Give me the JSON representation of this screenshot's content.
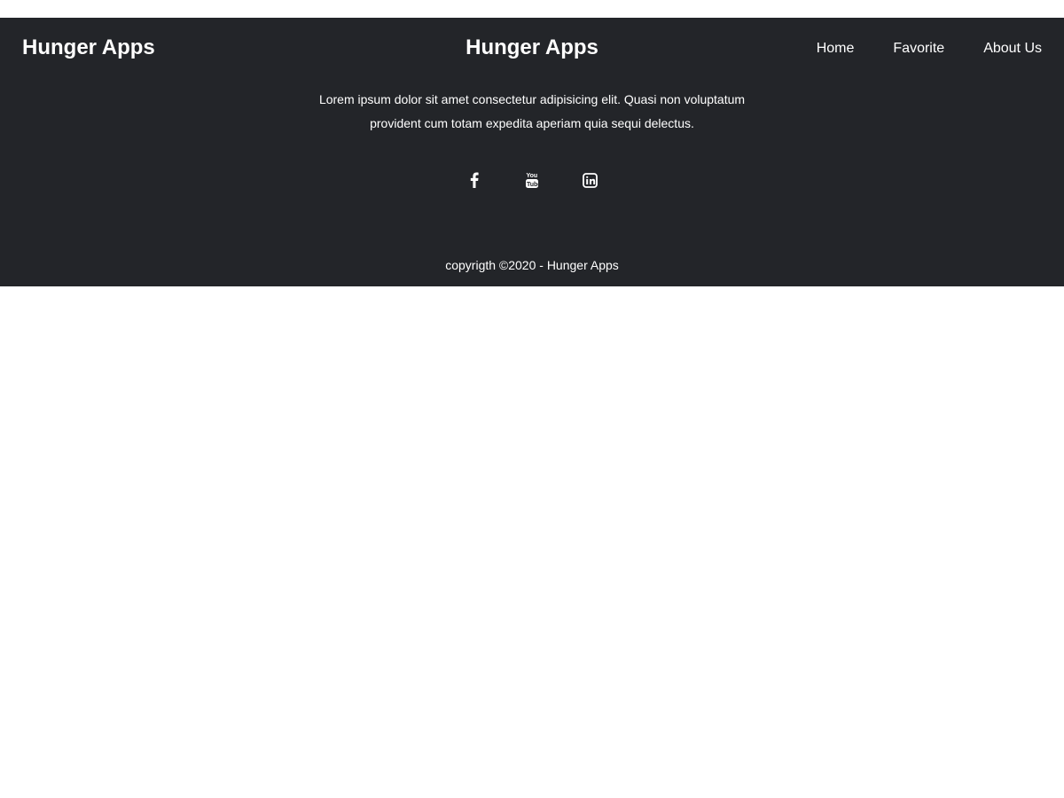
{
  "header": {
    "brand_left": "Hunger Apps",
    "brand_center": "Hunger Apps",
    "nav": [
      {
        "label": "Home"
      },
      {
        "label": "Favorite"
      },
      {
        "label": "About Us"
      }
    ]
  },
  "footer": {
    "description": "Lorem ipsum dolor sit amet consectetur adipisicing elit. Quasi non voluptatum provident cum totam expedita aperiam quia sequi delectus.",
    "socials": [
      {
        "icon": "facebook-icon"
      },
      {
        "icon": "youtube-icon"
      },
      {
        "icon": "linkedin-icon"
      }
    ],
    "copyright": "copyrigth ©2020 - Hunger Apps"
  },
  "colors": {
    "footer_bg": "#232529",
    "text": "#ffffff",
    "page_bg": "#ffffff"
  }
}
